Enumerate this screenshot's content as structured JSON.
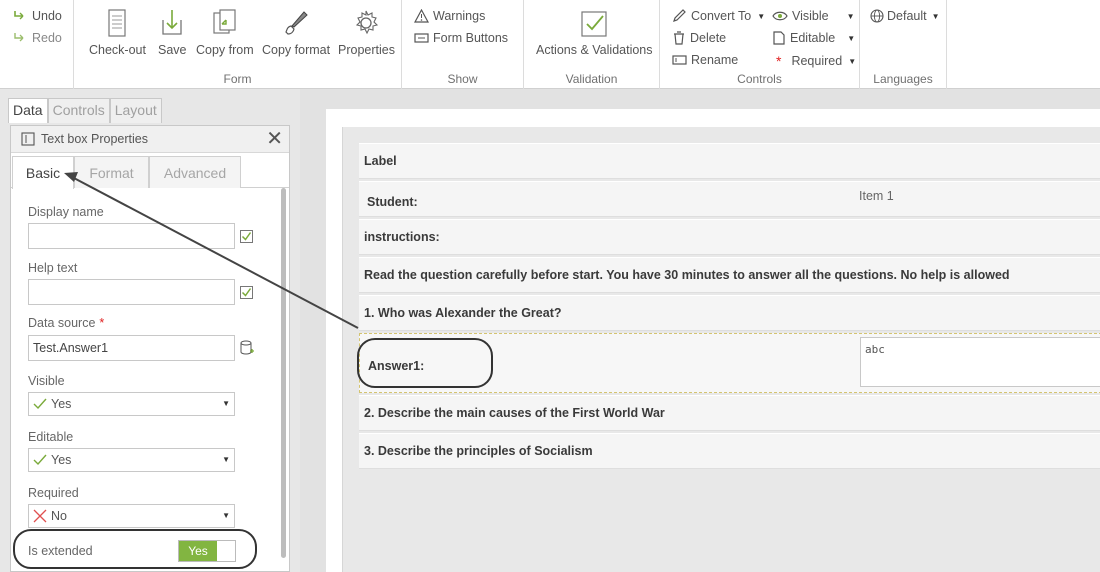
{
  "ribbon": {
    "undo": "Undo",
    "redo": "Redo",
    "form_group": {
      "label": "Form",
      "checkout": "Check-out",
      "save": "Save",
      "copy_from": "Copy from",
      "copy_format": "Copy format",
      "properties": "Properties"
    },
    "show_group": {
      "label": "Show",
      "warnings": "Warnings",
      "form_buttons": "Form Buttons"
    },
    "validation_group": {
      "label": "Validation",
      "actions": "Actions & Validations"
    },
    "controls_group": {
      "label": "Controls",
      "convert_to": "Convert To",
      "delete": "Delete",
      "rename": "Rename",
      "visible": "Visible",
      "editable": "Editable",
      "required": "Required"
    },
    "languages_group": {
      "label": "Languages",
      "default": "Default"
    }
  },
  "panel": {
    "tabs": [
      "Data",
      "Controls",
      "Layout"
    ],
    "title": "Text box Properties",
    "subtabs": [
      "Basic",
      "Format",
      "Advanced"
    ],
    "display_name_label": "Display name",
    "display_name_value": "",
    "help_text_label": "Help text",
    "help_text_value": "",
    "data_source_label": "Data source",
    "data_source_required_mark": "*",
    "data_source_value": "Test.Answer1",
    "visible_label": "Visible",
    "visible_value": "Yes",
    "editable_label": "Editable",
    "editable_value": "Yes",
    "required_label": "Required",
    "required_value": "No",
    "is_extended_label": "Is extended",
    "is_extended_value": "Yes"
  },
  "form": {
    "label_row": "Label",
    "student_label": "Student:",
    "student_value": "Item 1",
    "instructions_label": "instructions:",
    "instructions_text": "Read the question carefully before start. You have 30 minutes to answer all the questions. No help is allowed",
    "q1": "1. Who was Alexander the Great?",
    "answer1_label": "Answer1:",
    "answer1_value": "abc",
    "q2": "2. Describe the main causes of the First World War",
    "q3": "3. Describe the principles of Socialism"
  },
  "colors": {
    "accent_green": "#82b541",
    "required_red": "#e02020",
    "selection_dash": "#d4c470"
  }
}
